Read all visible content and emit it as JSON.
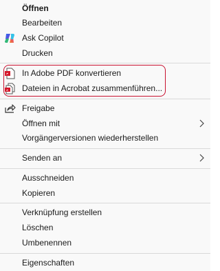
{
  "menu": {
    "items": [
      {
        "label": "Öffnen",
        "bold": true
      },
      {
        "label": "Bearbeiten"
      },
      {
        "label": "Ask Copilot",
        "icon": "copilot-icon"
      },
      {
        "label": "Drucken"
      },
      {
        "label": "In Adobe PDF konvertieren",
        "icon": "adobe-pdf-icon"
      },
      {
        "label": "Dateien in Acrobat zusammenführen...",
        "icon": "acrobat-combine-icon"
      },
      {
        "label": "Freigabe",
        "icon": "share-icon"
      },
      {
        "label": "Öffnen mit",
        "submenu": true
      },
      {
        "label": "Vorgängerversionen wiederherstellen"
      },
      {
        "label": "Senden an",
        "submenu": true
      },
      {
        "label": "Ausschneiden"
      },
      {
        "label": "Kopieren"
      },
      {
        "label": "Verknüpfung erstellen"
      },
      {
        "label": "Löschen"
      },
      {
        "label": "Umbenennen"
      },
      {
        "label": "Eigenschaften"
      }
    ]
  },
  "colors": {
    "highlight_border": "#c8102e",
    "adobe_red": "#d4172a",
    "separator": "#d9d9d9"
  }
}
